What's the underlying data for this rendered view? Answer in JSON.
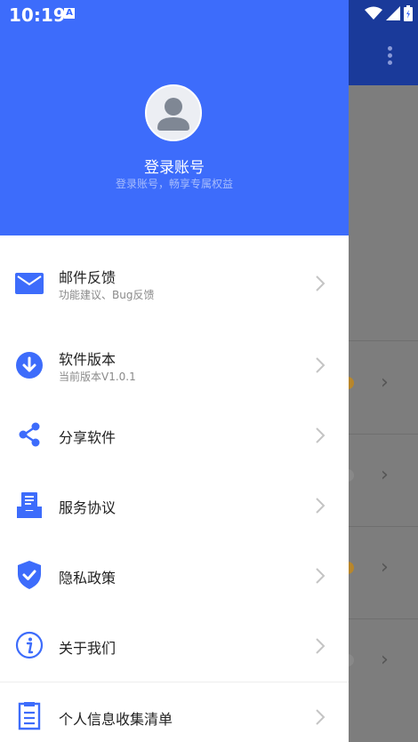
{
  "status_bar": {
    "time": "10:19",
    "notification_icon": "A",
    "icons": [
      "wifi-icon",
      "signal-icon",
      "battery-icon"
    ]
  },
  "drawer": {
    "header": {
      "title": "登录账号",
      "subtitle": "登录账号，畅享专属权益",
      "background": "#3d6cfb"
    },
    "items": [
      {
        "icon": "mail-icon",
        "title": "邮件反馈",
        "subtitle": "功能建议、Bug反馈"
      },
      {
        "icon": "download-icon",
        "title": "软件版本",
        "subtitle": "当前版本V1.0.1"
      },
      {
        "icon": "share-icon",
        "title": "分享软件"
      },
      {
        "icon": "document-tray-icon",
        "title": "服务协议"
      },
      {
        "icon": "shield-check-icon",
        "title": "隐私政策"
      },
      {
        "icon": "info-icon",
        "title": "关于我们"
      },
      {
        "icon": "list-icon",
        "title": "个人信息收集清单"
      }
    ]
  },
  "background_app": {
    "toolbar_color": "#1a3a9a",
    "more_icon": "more-vert-icon"
  },
  "colors": {
    "accent": "#3d6cfb",
    "icon": "#3d6cfb"
  }
}
